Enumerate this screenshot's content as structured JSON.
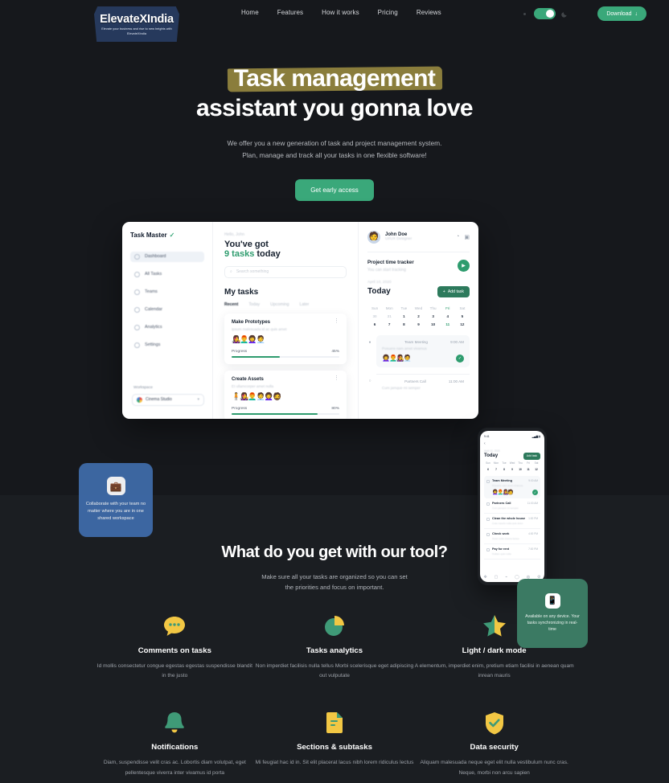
{
  "header": {
    "logo_name": "ElevateXIndia",
    "logo_tagline": "Elevate your business and rise to new heights with ElevateXIndia",
    "nav": [
      {
        "label": "Home"
      },
      {
        "label": "Features"
      },
      {
        "label": "How it works"
      },
      {
        "label": "Pricing"
      },
      {
        "label": "Reviews"
      }
    ],
    "theme_toggle_state": "on",
    "download_label": "Download",
    "download_arrow": "↓"
  },
  "hero": {
    "title_highlight": "Task management",
    "title_rest": "assistant you gonna love",
    "sub_line1": "We offer you a new generation of task and project management system.",
    "sub_line2": "Plan, manage and track all your tasks in one flexible software!",
    "cta_label": "Get early access"
  },
  "mockup": {
    "app_name": "Task Master",
    "sidebar": [
      {
        "label": "Dashboard"
      },
      {
        "label": "All Tasks"
      },
      {
        "label": "Teams"
      },
      {
        "label": "Calendar"
      },
      {
        "label": "Analytics"
      },
      {
        "label": "Settings"
      }
    ],
    "workspace_label": "Workspace",
    "workspace_value": "Cinema Studio",
    "greeting": "Hello, John",
    "headline_1": "You've got",
    "headline_count": "9 tasks",
    "headline_2": " today",
    "search_placeholder": "Search something",
    "my_tasks_title": "My tasks",
    "task_tabs": [
      {
        "label": "Recent"
      },
      {
        "label": "Today"
      },
      {
        "label": "Upcoming"
      },
      {
        "label": "Later"
      }
    ],
    "tasks": [
      {
        "title": "Make Prototypes",
        "desc": "Ipsum malesuada id ac quis amet",
        "progress_label": "Progress",
        "progress": "45%"
      },
      {
        "title": "Create Assets",
        "desc": "Et ullamcorper amet nulla",
        "progress_label": "Progress",
        "progress": "80%"
      }
    ],
    "profile_name": "John Doe",
    "profile_role": "UI/UX Designer",
    "tracker_title": "Project time tracker",
    "tracker_sub": "You can start tracking",
    "date_string": "April 10, 2020",
    "today_title": "Today",
    "add_task_label": "Add task",
    "calendar_days": [
      "Sun",
      "Mon",
      "Tue",
      "Wed",
      "Thu",
      "Fri",
      "Sat"
    ],
    "calendar_week1": [
      "30",
      "31",
      "1",
      "2",
      "3",
      "4",
      "5"
    ],
    "calendar_week2": [
      "6",
      "7",
      "8",
      "9",
      "10",
      "11",
      "12"
    ],
    "events": [
      {
        "title": "Team Meeting",
        "time": "9:00 AM",
        "desc": "Posuere nam amet vivamus"
      },
      {
        "title": "Partners Call",
        "time": "11:00 AM",
        "desc": "Cum jamque mi semper"
      }
    ],
    "phone": {
      "status_time": "9:41",
      "today_title": "Today",
      "date_string": "April 10, 2020",
      "add_label": "Add task",
      "days": [
        "Sun",
        "Mon",
        "Tue",
        "Wed",
        "Thu",
        "Fri",
        "Sat"
      ],
      "nums": [
        "6",
        "7",
        "8",
        "9",
        "10",
        "11",
        "12"
      ],
      "items": [
        {
          "title": "Team Meeting",
          "time": "9:00 AM",
          "desc": "Posuere nam amet vivamus"
        },
        {
          "title": "Partners Call",
          "time": "11:00 AM",
          "desc": "Cum jamque mi semper"
        },
        {
          "title": "Clean the whole house",
          "time": "1:00 PM",
          "desc": "Cras mauris nulla quis dolor"
        },
        {
          "title": "Check work",
          "time": "4:00 PM",
          "desc": "Amet nulla viverra lectus"
        },
        {
          "title": "Pay for rent",
          "time": "7:00 PM",
          "desc": "Nullam quis nulla"
        }
      ]
    },
    "badge_blue": "Collaborate with your team no matter where you are in one shared workspace",
    "badge_green": "Available on any device. Your tasks synchronizing in real-time"
  },
  "features": {
    "title": "What do you get with our tool?",
    "sub_line1": "Make sure all your tasks are organized so you can set",
    "sub_line2": "the priorities and focus on important.",
    "items": [
      {
        "icon": "comment-bubble-icon",
        "title": "Comments on tasks",
        "desc": "Id mollis consectetur congue egestas egestas suspendisse blandit in the justo"
      },
      {
        "icon": "pie-chart-icon",
        "title": "Tasks analytics",
        "desc": "Non imperdiet facilisis nulla tellus Morbi scelerisque eget adipiscing out vulputate"
      },
      {
        "icon": "star-icon",
        "title": "Light / dark mode",
        "desc": "A elementum, imperdiet enim, pretium etiam facilisi in aenean quam inrean mauris"
      },
      {
        "icon": "bell-icon",
        "title": "Notifications",
        "desc": "Diam, suspendisse velit cras ac. Lobortis diam volutpat, eget pellentesque viverra inter vivamus id porta"
      },
      {
        "icon": "document-icon",
        "title": "Sections & subtasks",
        "desc": "Mi feugiat hac id in. Sit elit placerat lacus nibh lorem ridiculus lectus"
      },
      {
        "icon": "shield-check-icon",
        "title": "Data security",
        "desc": "Aliquam malesuada neque eget elit nulla vestibulum nunc cras. Neque, morbi non arcu sapien"
      }
    ]
  },
  "colors": {
    "accent_green": "#3aa87a",
    "page_bg": "#16181c",
    "section_bg": "#1b1e22",
    "highlight": "#8a7d3c",
    "icon_yellow": "#f2c744",
    "icon_green": "#3f9a77",
    "badge_blue": "#3f6cab"
  }
}
